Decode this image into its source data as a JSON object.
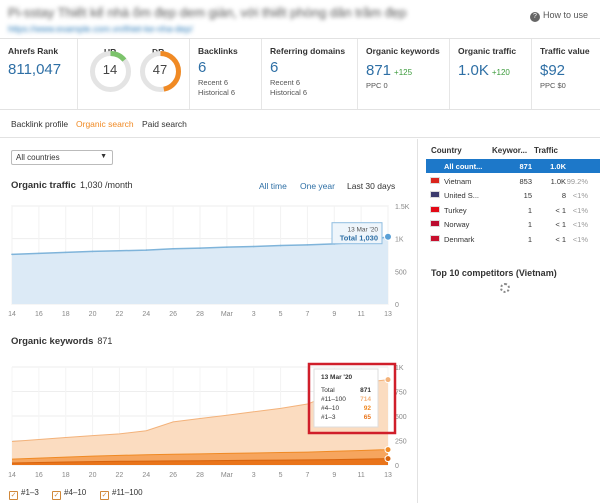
{
  "header": {
    "title": "Pi-sstay Thiết kế nhà ốm đẹp dem giàn, với thiết phòng dân trầm đẹp",
    "url": "https://www.example.com.vn/thiet-ke-nha-dep/",
    "how_to": "How to use"
  },
  "metrics": {
    "ahrefs_rank": {
      "label": "Ahrefs Rank",
      "value": "811,047"
    },
    "ur": {
      "label": "UR",
      "value": "14",
      "score": 14
    },
    "dr": {
      "label": "DR",
      "value": "47",
      "score": 47
    },
    "backlinks": {
      "label": "Backlinks",
      "value": "6",
      "recent": "Recent 6",
      "historical": "Historical 6"
    },
    "referring_domains": {
      "label": "Referring domains",
      "value": "6",
      "recent": "Recent 6",
      "historical": "Historical 6"
    },
    "organic_keywords": {
      "label": "Organic keywords",
      "value": "871",
      "delta": "+125",
      "ppc": "PPC 0"
    },
    "organic_traffic": {
      "label": "Organic traffic",
      "value": "1.0K",
      "delta": "+120"
    },
    "traffic_value": {
      "label": "Traffic value",
      "value": "$92",
      "ppc": "PPC $0"
    }
  },
  "tabs": [
    "Backlink profile",
    "Organic search",
    "Paid search"
  ],
  "filter": {
    "selected": "All countries"
  },
  "traffic_section": {
    "title": "Organic traffic",
    "value": "1,030 /month",
    "ranges": [
      "All time",
      "One year",
      "Last 30 days"
    ]
  },
  "keywords_section": {
    "title": "Organic keywords",
    "value": "871"
  },
  "chart_data": [
    {
      "type": "area",
      "title": "Organic traffic",
      "x": [
        "14",
        "16",
        "18",
        "20",
        "22",
        "24",
        "26",
        "28",
        "Mar",
        "3",
        "5",
        "7",
        "9",
        "11",
        "13"
      ],
      "series": [
        {
          "values": [
            760,
            775,
            790,
            805,
            815,
            825,
            845,
            855,
            870,
            880,
            895,
            905,
            920,
            950,
            1030
          ]
        }
      ],
      "ylim": [
        0,
        1500
      ],
      "yticks": [
        "1.5K",
        "1K",
        "500",
        "0"
      ],
      "color": "#7fb4da",
      "tooltip": {
        "date": "13 Mar '20",
        "text": "Total 1,030"
      }
    },
    {
      "type": "area",
      "title": "Organic keywords",
      "x": [
        "14",
        "16",
        "18",
        "20",
        "22",
        "24",
        "26",
        "28",
        "Mar",
        "3",
        "5",
        "7",
        "9",
        "11",
        "13"
      ],
      "series": [
        {
          "name": "#11–100",
          "values": [
            180,
            190,
            200,
            210,
            220,
            245,
            330,
            360,
            390,
            420,
            450,
            490,
            590,
            690,
            714
          ]
        },
        {
          "name": "#4–10",
          "values": [
            40,
            45,
            50,
            55,
            60,
            65,
            68,
            70,
            72,
            75,
            78,
            80,
            85,
            88,
            92
          ]
        },
        {
          "name": "#1–3",
          "values": [
            20,
            25,
            30,
            35,
            38,
            40,
            42,
            44,
            46,
            48,
            50,
            52,
            55,
            60,
            65
          ]
        }
      ],
      "ylim": [
        0,
        1000
      ],
      "yticks": [
        "1K",
        "750",
        "500",
        "250",
        "0"
      ],
      "tooltip": {
        "date": "13 Mar '20",
        "rows": [
          {
            "label": "Total",
            "value": "871"
          },
          {
            "label": "#11–100",
            "value": "714"
          },
          {
            "label": "#4–10",
            "value": "92"
          },
          {
            "label": "#1–3",
            "value": "65"
          }
        ]
      }
    }
  ],
  "country_table": {
    "headers": [
      "Country",
      "Keywor...",
      "Traffic"
    ],
    "rows": [
      {
        "country": "All count...",
        "keywords": "871",
        "traffic": "1.0K",
        "pct": "",
        "flag": ""
      },
      {
        "country": "Vietnam",
        "keywords": "853",
        "traffic": "1.0K",
        "pct": "99.2%",
        "flag": "#da251d"
      },
      {
        "country": "United S...",
        "keywords": "15",
        "traffic": "8",
        "pct": "<1%",
        "flag": "#3c3b6e"
      },
      {
        "country": "Turkey",
        "keywords": "1",
        "traffic": "< 1",
        "pct": "<1%",
        "flag": "#e30a17"
      },
      {
        "country": "Norway",
        "keywords": "1",
        "traffic": "< 1",
        "pct": "<1%",
        "flag": "#ba0c2f"
      },
      {
        "country": "Denmark",
        "keywords": "1",
        "traffic": "< 1",
        "pct": "<1%",
        "flag": "#c8102e"
      }
    ]
  },
  "competitors": {
    "title": "Top 10 competitors (Vietnam)"
  },
  "legend": [
    "#1–3",
    "#4–10",
    "#11–100"
  ],
  "colors": {
    "accent": "#f08a24",
    "link": "#2e6fa5",
    "highlight": "#1d78c9",
    "tooltip_border": "#d01e2a"
  }
}
